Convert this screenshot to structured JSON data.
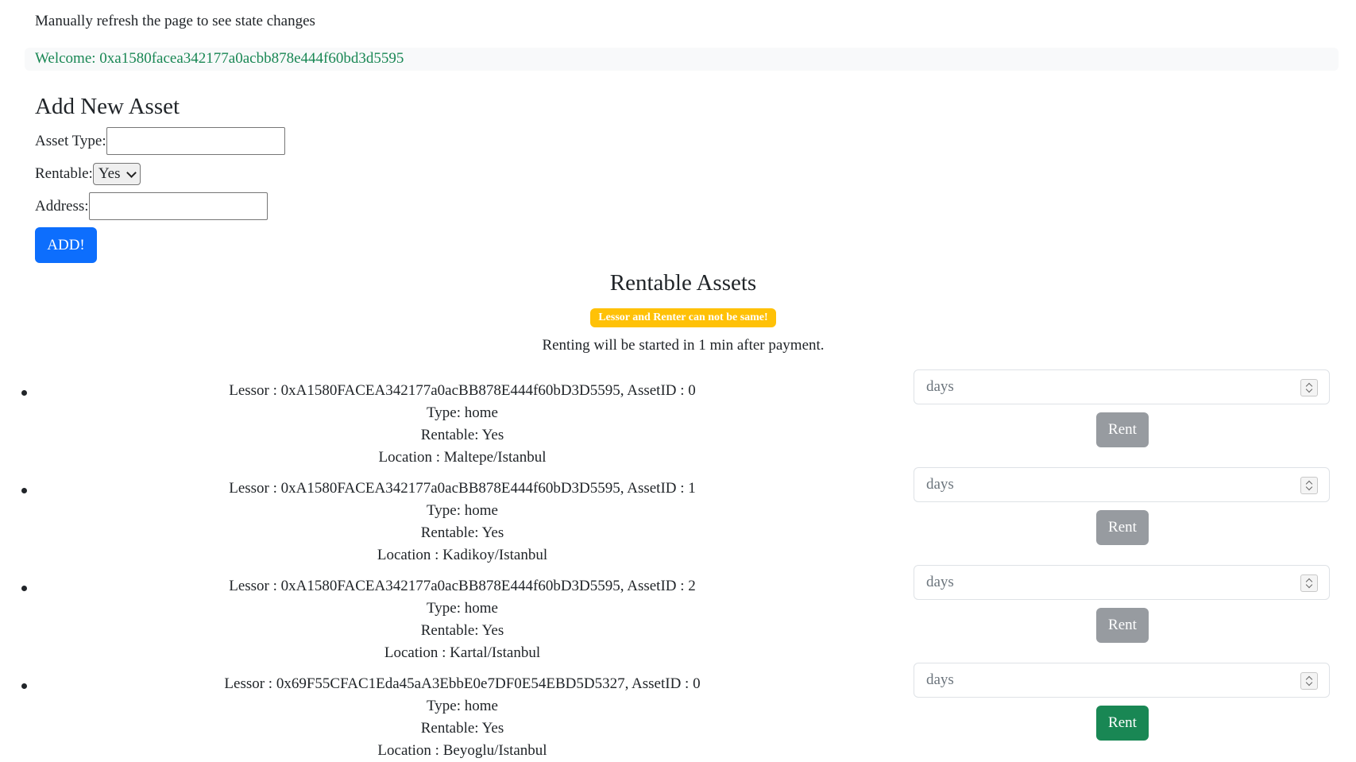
{
  "header": {
    "refresh_note": "Manually refresh the page to see state changes",
    "welcome": "Welcome: 0xa1580facea342177a0acbb878e444f60bd3d5595"
  },
  "add_form": {
    "title": "Add New Asset",
    "asset_type_label": "Asset Type:",
    "asset_type_value": "",
    "rentable_label": "Rentable:",
    "rentable_selected": "Yes",
    "address_label": "Address:",
    "address_value": "",
    "add_button": "ADD!"
  },
  "rentable": {
    "title": "Rentable Assets",
    "warning": "Lessor and Renter can not be same!",
    "note": "Renting will be started in 1 min after payment."
  },
  "assets": [
    {
      "lessor_line": "Lessor : 0xA1580FACEA342177a0acBB878E444f60bD3D5595, AssetID : 0",
      "type_line": "Type: home",
      "rentable_line": "Rentable: Yes",
      "location_line": "Location : Maltepe/Istanbul",
      "days_placeholder": "days",
      "rent_label": "Rent",
      "rent_enabled": false
    },
    {
      "lessor_line": "Lessor : 0xA1580FACEA342177a0acBB878E444f60bD3D5595, AssetID : 1",
      "type_line": "Type: home",
      "rentable_line": "Rentable: Yes",
      "location_line": "Location : Kadikoy/Istanbul",
      "days_placeholder": "days",
      "rent_label": "Rent",
      "rent_enabled": false
    },
    {
      "lessor_line": "Lessor : 0xA1580FACEA342177a0acBB878E444f60bD3D5595, AssetID : 2",
      "type_line": "Type: home",
      "rentable_line": "Rentable: Yes",
      "location_line": "Location : Kartal/Istanbul",
      "days_placeholder": "days",
      "rent_label": "Rent",
      "rent_enabled": false
    },
    {
      "lessor_line": "Lessor : 0x69F55CFAC1Eda45aA3EbbE0e7DF0E54EBD5D5327, AssetID : 0",
      "type_line": "Type: home",
      "rentable_line": "Rentable: Yes",
      "location_line": "Location : Beyoglu/Istanbul",
      "days_placeholder": "days",
      "rent_label": "Rent",
      "rent_enabled": true
    }
  ],
  "colors": {
    "welcome_text": "#198754",
    "add_button": "#0d6efd",
    "warning_badge": "#ffc107",
    "rent_disabled": "#979ba0",
    "rent_enabled": "#198754"
  },
  "icons": {
    "select_chevron": "chevron-down-icon",
    "number_spinner": "spinner-arrows-icon"
  }
}
